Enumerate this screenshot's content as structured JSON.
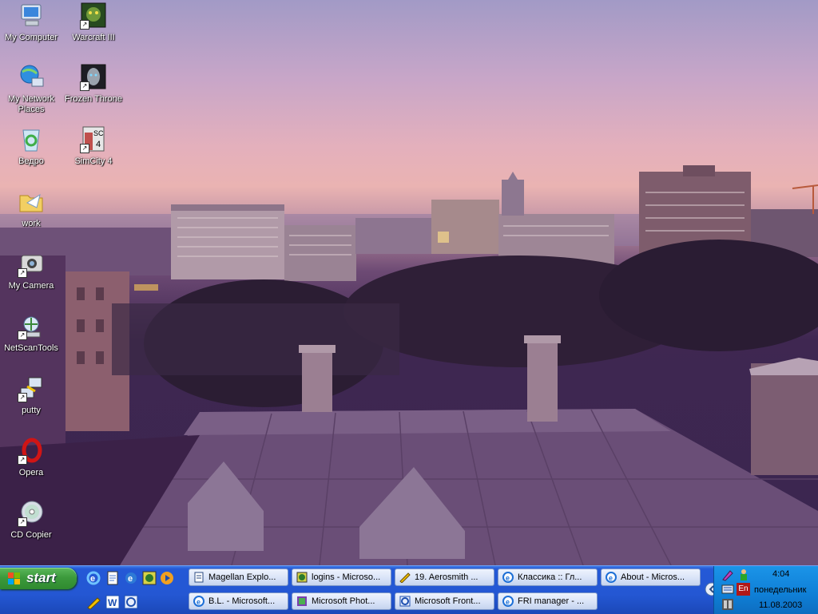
{
  "desktop": {
    "icons": [
      {
        "label": "My Computer",
        "icon": "my-computer-icon"
      },
      {
        "label": "Warcraft III",
        "icon": "warcraft-icon"
      },
      {
        "label": "My Network Places",
        "icon": "network-places-icon"
      },
      {
        "label": "Frozen Throne",
        "icon": "frozen-throne-icon"
      },
      {
        "label": "Ведро",
        "icon": "recycle-bin-icon"
      },
      {
        "label": "SimCity 4",
        "icon": "simcity-icon"
      },
      {
        "label": "work",
        "icon": "folder-icon"
      },
      {
        "label": "My Camera",
        "icon": "camera-icon"
      },
      {
        "label": "NetScanTools",
        "icon": "netscan-icon"
      },
      {
        "label": "putty",
        "icon": "putty-icon"
      },
      {
        "label": "Opera",
        "icon": "opera-icon"
      },
      {
        "label": "CD Copier",
        "icon": "cd-icon"
      }
    ]
  },
  "taskbar": {
    "start_label": "start",
    "quick_launch": [
      "ie-icon",
      "notepad-icon",
      "ie-alt-icon",
      "app-icon",
      "media-player-icon",
      "pencil-icon",
      "word-icon",
      "frontpage-icon"
    ],
    "tasks_row1": [
      {
        "label": "Magellan Explo...",
        "icon": "document-icon"
      },
      {
        "label": "logins - Microso...",
        "icon": "app-icon"
      },
      {
        "label": "19. Aerosmith ...",
        "icon": "winamp-icon"
      },
      {
        "label": "Классика :: Гл...",
        "icon": "ie-icon"
      },
      {
        "label": "About - Micros...",
        "icon": "ie-icon"
      }
    ],
    "tasks_row2": [
      {
        "label": "B.L. - Microsoft...",
        "icon": "ie-icon"
      },
      {
        "label": "Microsoft Phot...",
        "icon": "photo-icon"
      },
      {
        "label": "Microsoft Front...",
        "icon": "frontpage-icon"
      },
      {
        "label": "FRI manager - ...",
        "icon": "ie-icon"
      }
    ]
  },
  "tray": {
    "time": "4:04",
    "day": "понедельник",
    "date": "11.08.2003",
    "language": "En",
    "colors": {
      "taskbar": "#2457d3",
      "tray": "#0f7fd6",
      "start": "#3c9a3c"
    }
  }
}
